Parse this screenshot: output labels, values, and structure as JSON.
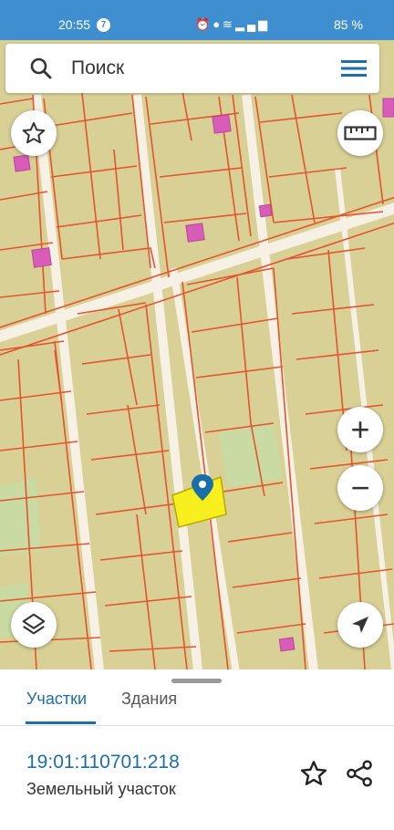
{
  "status_bar": {
    "time": "20:55",
    "notification_count": "7",
    "icons": [
      "alarm-icon",
      "location-icon",
      "wifi-icon",
      "volte-icon",
      "signal-icon",
      "signal-icon"
    ],
    "battery": "85 %"
  },
  "search": {
    "placeholder": "Поиск"
  },
  "map": {
    "parcel_fill": "#d8d095",
    "boundary_color": "#e4542e",
    "road_color": "#f6f0e5",
    "building_color": "#d85cb8",
    "selected_fill": "#f7ef1e",
    "marker_color": "#1a6fa9"
  },
  "controls": {
    "favorite": "star-icon",
    "ruler": "ruler-icon",
    "zoom_in": "+",
    "zoom_out": "−",
    "layers": "layers-icon",
    "locate": "navigation-icon"
  },
  "tabs": [
    {
      "label": "Участки",
      "active": true
    },
    {
      "label": "Здания",
      "active": false
    }
  ],
  "object": {
    "cadastral_number": "19:01:110701:218",
    "type": "Земельный участок"
  },
  "accent_color": "#1e6ea8"
}
